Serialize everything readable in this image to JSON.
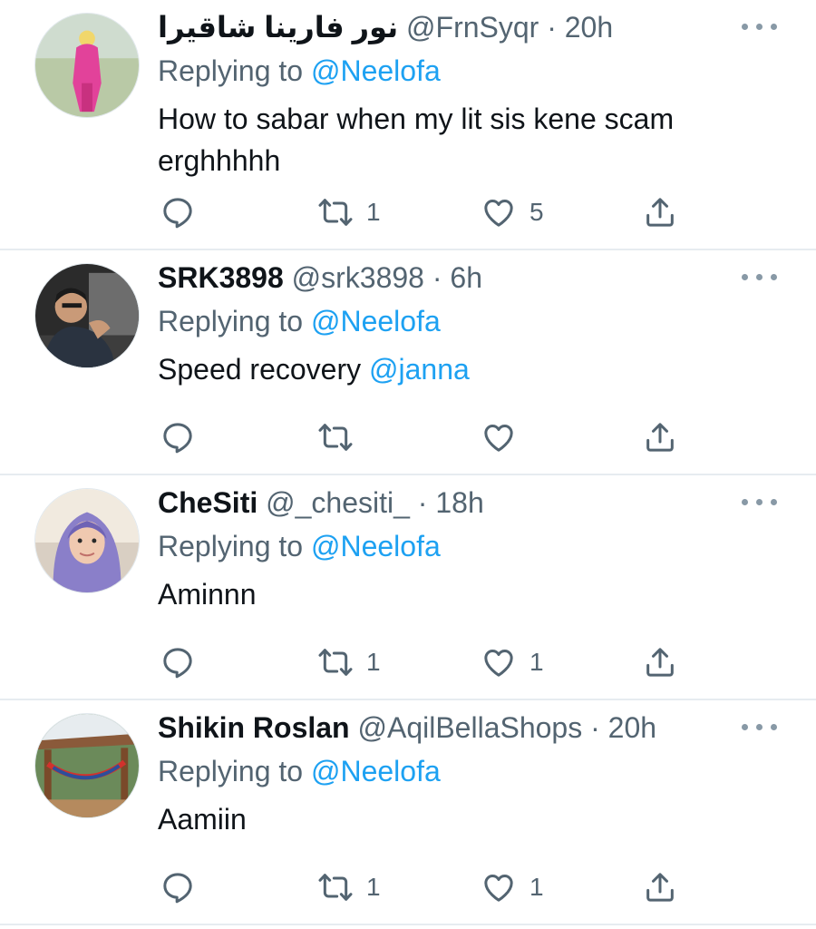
{
  "tweets": [
    {
      "display_name": "نور فارينا شاقيرا",
      "handle": "@FrnSyqr",
      "time": "20h",
      "replying_label": "Replying to",
      "replying_to": "@Neelofa",
      "text": "How to sabar when my lit sis kene scam erghhhhh",
      "mention": "",
      "retweets": "1",
      "likes": "5"
    },
    {
      "display_name": "SRK3898",
      "handle": "@srk3898",
      "time": "6h",
      "replying_label": "Replying to",
      "replying_to": "@Neelofa",
      "text": "Speed recovery ",
      "mention": "@janna",
      "retweets": "",
      "likes": ""
    },
    {
      "display_name": "CheSiti",
      "handle": "@_chesiti_",
      "time": "18h",
      "replying_label": "Replying to",
      "replying_to": "@Neelofa",
      "text": "Aminnn",
      "mention": "",
      "retweets": "1",
      "likes": "1"
    },
    {
      "display_name": "Shikin Roslan",
      "handle": "@AqilBellaShops",
      "time": "20h",
      "replying_label": "Replying to",
      "replying_to": "@Neelofa",
      "text": "Aamiin",
      "mention": "",
      "retweets": "1",
      "likes": "1"
    }
  ],
  "separator": "·",
  "icons": {
    "reply": "reply-bubble-icon",
    "retweet": "retweet-arrows-icon",
    "like": "heart-icon",
    "share": "share-upload-icon",
    "more": "more-dots-icon"
  },
  "colors": {
    "link": "#1da1f2",
    "secondary_text": "#536471",
    "icon": "#536471",
    "divider": "#e6ecf0"
  }
}
